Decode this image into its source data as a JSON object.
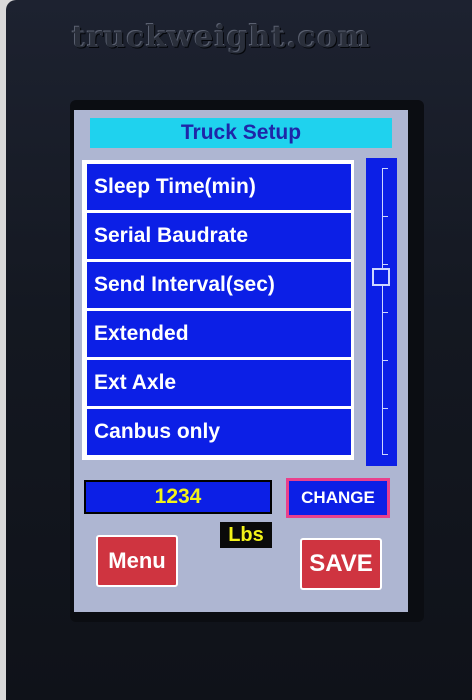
{
  "device": {
    "brand": "truckweight.com"
  },
  "screen": {
    "title": "Truck Setup",
    "menu_items": [
      {
        "label": "Sleep Time(min)"
      },
      {
        "label": "Serial Baudrate"
      },
      {
        "label": "Send Interval(sec)"
      },
      {
        "label": "Extended"
      },
      {
        "label": "Ext Axle"
      },
      {
        "label": "Canbus only"
      }
    ],
    "scroll_position_fraction": 0.38,
    "value": "1234",
    "unit": "Lbs",
    "change_label": "CHANGE",
    "menu_label": "Menu",
    "save_label": "SAVE"
  },
  "colors": {
    "screen_bg": "#aeb6d2",
    "title_bg": "#1fd2ee",
    "title_text": "#1f26a8",
    "item_bg": "#0c1fe6",
    "value_text": "#f2f219",
    "button_red": "#cf3440",
    "change_border": "#e9408c"
  }
}
